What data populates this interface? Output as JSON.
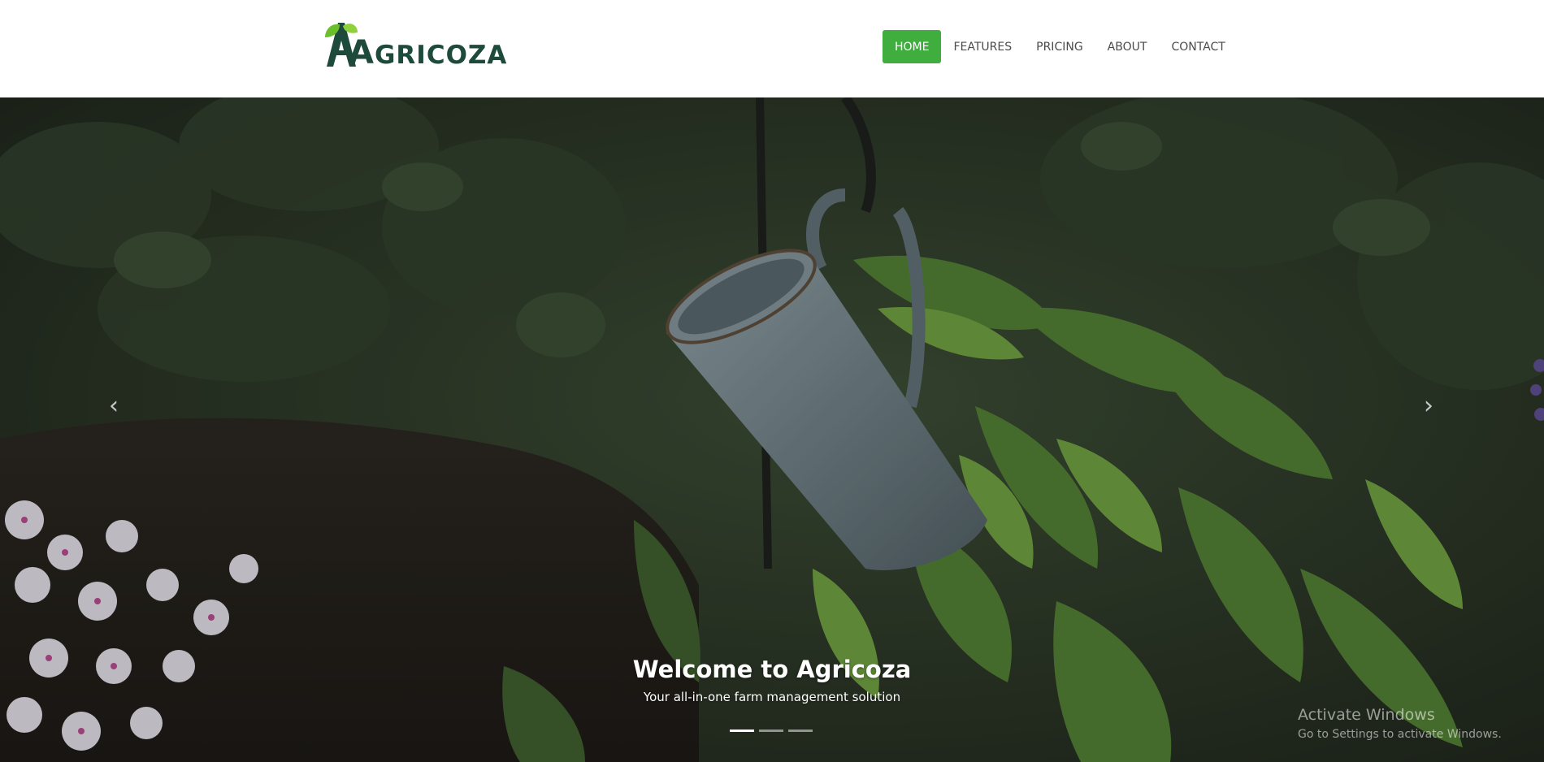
{
  "brand": {
    "name_first": "A",
    "name_rest": "GRICOZA",
    "color": "#1d4a3a",
    "leaf_color": "#6cbf2c"
  },
  "nav": {
    "items": [
      {
        "label": "HOME",
        "active": true
      },
      {
        "label": "FEATURES",
        "active": false
      },
      {
        "label": "PRICING",
        "active": false
      },
      {
        "label": "ABOUT",
        "active": false
      },
      {
        "label": "CONTACT",
        "active": false
      }
    ],
    "active_color": "#3fae3f"
  },
  "carousel": {
    "prev_icon": "chevron-left-icon",
    "next_icon": "chevron-right-icon",
    "prev_glyph": "‹",
    "next_glyph": "›",
    "caption_title": "Welcome to Agricoza",
    "caption_subtitle": "Your all-in-one farm management solution",
    "slide_count": 3,
    "active_slide": 1
  },
  "watermark": {
    "title": "Activate Windows",
    "subtitle": "Go to Settings to activate Windows."
  }
}
